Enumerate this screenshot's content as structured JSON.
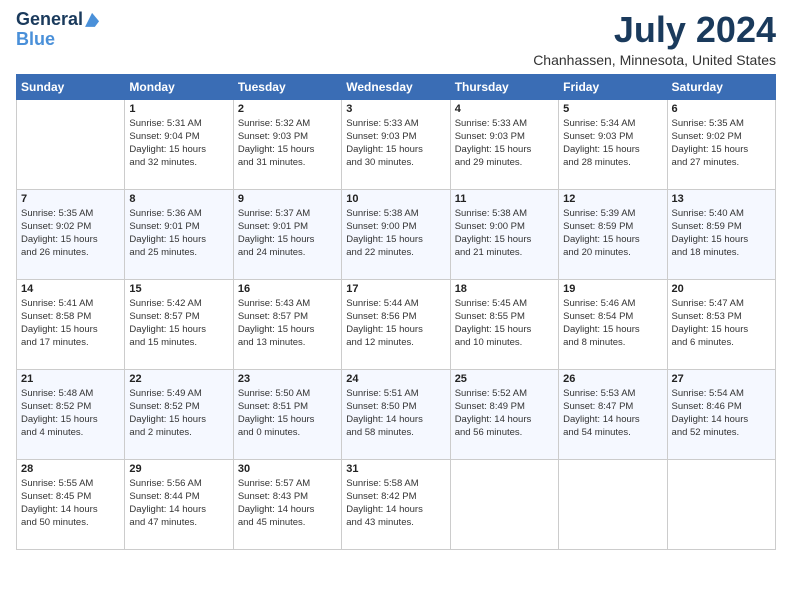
{
  "header": {
    "logo_general": "General",
    "logo_blue": "Blue",
    "month_title": "July 2024",
    "location": "Chanhassen, Minnesota, United States"
  },
  "weekdays": [
    "Sunday",
    "Monday",
    "Tuesday",
    "Wednesday",
    "Thursday",
    "Friday",
    "Saturday"
  ],
  "weeks": [
    [
      {
        "day": "",
        "info": ""
      },
      {
        "day": "1",
        "info": "Sunrise: 5:31 AM\nSunset: 9:04 PM\nDaylight: 15 hours\nand 32 minutes."
      },
      {
        "day": "2",
        "info": "Sunrise: 5:32 AM\nSunset: 9:03 PM\nDaylight: 15 hours\nand 31 minutes."
      },
      {
        "day": "3",
        "info": "Sunrise: 5:33 AM\nSunset: 9:03 PM\nDaylight: 15 hours\nand 30 minutes."
      },
      {
        "day": "4",
        "info": "Sunrise: 5:33 AM\nSunset: 9:03 PM\nDaylight: 15 hours\nand 29 minutes."
      },
      {
        "day": "5",
        "info": "Sunrise: 5:34 AM\nSunset: 9:03 PM\nDaylight: 15 hours\nand 28 minutes."
      },
      {
        "day": "6",
        "info": "Sunrise: 5:35 AM\nSunset: 9:02 PM\nDaylight: 15 hours\nand 27 minutes."
      }
    ],
    [
      {
        "day": "7",
        "info": "Sunrise: 5:35 AM\nSunset: 9:02 PM\nDaylight: 15 hours\nand 26 minutes."
      },
      {
        "day": "8",
        "info": "Sunrise: 5:36 AM\nSunset: 9:01 PM\nDaylight: 15 hours\nand 25 minutes."
      },
      {
        "day": "9",
        "info": "Sunrise: 5:37 AM\nSunset: 9:01 PM\nDaylight: 15 hours\nand 24 minutes."
      },
      {
        "day": "10",
        "info": "Sunrise: 5:38 AM\nSunset: 9:00 PM\nDaylight: 15 hours\nand 22 minutes."
      },
      {
        "day": "11",
        "info": "Sunrise: 5:38 AM\nSunset: 9:00 PM\nDaylight: 15 hours\nand 21 minutes."
      },
      {
        "day": "12",
        "info": "Sunrise: 5:39 AM\nSunset: 8:59 PM\nDaylight: 15 hours\nand 20 minutes."
      },
      {
        "day": "13",
        "info": "Sunrise: 5:40 AM\nSunset: 8:59 PM\nDaylight: 15 hours\nand 18 minutes."
      }
    ],
    [
      {
        "day": "14",
        "info": "Sunrise: 5:41 AM\nSunset: 8:58 PM\nDaylight: 15 hours\nand 17 minutes."
      },
      {
        "day": "15",
        "info": "Sunrise: 5:42 AM\nSunset: 8:57 PM\nDaylight: 15 hours\nand 15 minutes."
      },
      {
        "day": "16",
        "info": "Sunrise: 5:43 AM\nSunset: 8:57 PM\nDaylight: 15 hours\nand 13 minutes."
      },
      {
        "day": "17",
        "info": "Sunrise: 5:44 AM\nSunset: 8:56 PM\nDaylight: 15 hours\nand 12 minutes."
      },
      {
        "day": "18",
        "info": "Sunrise: 5:45 AM\nSunset: 8:55 PM\nDaylight: 15 hours\nand 10 minutes."
      },
      {
        "day": "19",
        "info": "Sunrise: 5:46 AM\nSunset: 8:54 PM\nDaylight: 15 hours\nand 8 minutes."
      },
      {
        "day": "20",
        "info": "Sunrise: 5:47 AM\nSunset: 8:53 PM\nDaylight: 15 hours\nand 6 minutes."
      }
    ],
    [
      {
        "day": "21",
        "info": "Sunrise: 5:48 AM\nSunset: 8:52 PM\nDaylight: 15 hours\nand 4 minutes."
      },
      {
        "day": "22",
        "info": "Sunrise: 5:49 AM\nSunset: 8:52 PM\nDaylight: 15 hours\nand 2 minutes."
      },
      {
        "day": "23",
        "info": "Sunrise: 5:50 AM\nSunset: 8:51 PM\nDaylight: 15 hours\nand 0 minutes."
      },
      {
        "day": "24",
        "info": "Sunrise: 5:51 AM\nSunset: 8:50 PM\nDaylight: 14 hours\nand 58 minutes."
      },
      {
        "day": "25",
        "info": "Sunrise: 5:52 AM\nSunset: 8:49 PM\nDaylight: 14 hours\nand 56 minutes."
      },
      {
        "day": "26",
        "info": "Sunrise: 5:53 AM\nSunset: 8:47 PM\nDaylight: 14 hours\nand 54 minutes."
      },
      {
        "day": "27",
        "info": "Sunrise: 5:54 AM\nSunset: 8:46 PM\nDaylight: 14 hours\nand 52 minutes."
      }
    ],
    [
      {
        "day": "28",
        "info": "Sunrise: 5:55 AM\nSunset: 8:45 PM\nDaylight: 14 hours\nand 50 minutes."
      },
      {
        "day": "29",
        "info": "Sunrise: 5:56 AM\nSunset: 8:44 PM\nDaylight: 14 hours\nand 47 minutes."
      },
      {
        "day": "30",
        "info": "Sunrise: 5:57 AM\nSunset: 8:43 PM\nDaylight: 14 hours\nand 45 minutes."
      },
      {
        "day": "31",
        "info": "Sunrise: 5:58 AM\nSunset: 8:42 PM\nDaylight: 14 hours\nand 43 minutes."
      },
      {
        "day": "",
        "info": ""
      },
      {
        "day": "",
        "info": ""
      },
      {
        "day": "",
        "info": ""
      }
    ]
  ]
}
